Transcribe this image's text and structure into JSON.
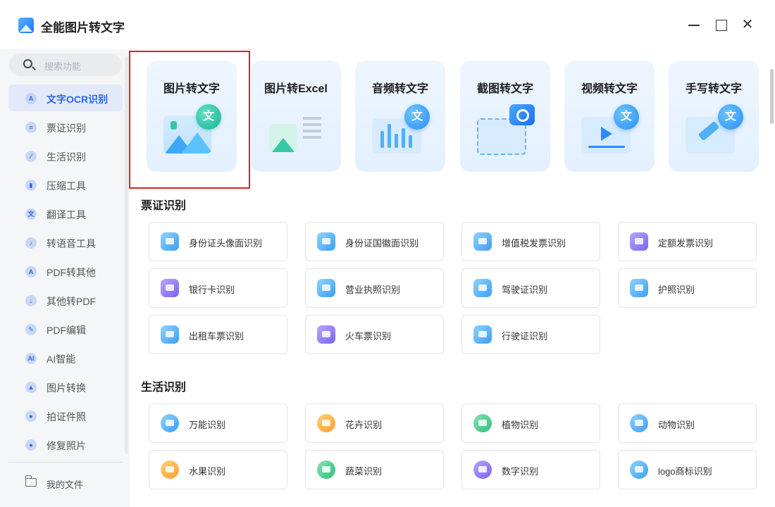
{
  "app": {
    "title": "全能图片转文字"
  },
  "window_controls": {
    "close_glyph": "✕"
  },
  "sidebar": {
    "search_placeholder": "搜索功能",
    "items": [
      {
        "label": "文字OCR识别",
        "icon": "ocr-icon",
        "glyph": "A",
        "active": true
      },
      {
        "label": "票证识别",
        "icon": "ticket-icon",
        "glyph": "≡"
      },
      {
        "label": "生活识别",
        "icon": "life-icon",
        "glyph": "⁄"
      },
      {
        "label": "压缩工具",
        "icon": "compress-icon",
        "glyph": "▮"
      },
      {
        "label": "翻译工具",
        "icon": "translate-icon",
        "glyph": "文"
      },
      {
        "label": "转语音工具",
        "icon": "voice-icon",
        "glyph": "♪"
      },
      {
        "label": "PDF转其他",
        "icon": "pdf-convert-icon",
        "glyph": "A"
      },
      {
        "label": "其他转PDF",
        "icon": "to-pdf-icon",
        "glyph": "↓"
      },
      {
        "label": "PDF编辑",
        "icon": "pdf-edit-icon",
        "glyph": "✎"
      },
      {
        "label": "AI智能",
        "icon": "ai-icon",
        "glyph": "AI"
      },
      {
        "label": "图片转换",
        "icon": "image-convert-icon",
        "glyph": "▲"
      },
      {
        "label": "拍证件照",
        "icon": "id-photo-icon",
        "glyph": "●"
      },
      {
        "label": "修复照片",
        "icon": "repair-photo-icon",
        "glyph": "●"
      }
    ],
    "files_label": "我的文件"
  },
  "features": [
    {
      "title": "图片转文字",
      "badge": "文",
      "selected": true
    },
    {
      "title": "图片转Excel"
    },
    {
      "title": "音频转文字",
      "badge": "文"
    },
    {
      "title": "截图转文字"
    },
    {
      "title": "视频转文字",
      "badge": "文"
    },
    {
      "title": "手写转文字",
      "badge": "文"
    }
  ],
  "sections": [
    {
      "title": "票证识别",
      "items": [
        {
          "label": "身份证头像面识别",
          "color": "blue"
        },
        {
          "label": "身份证国徽面识别",
          "color": "blue"
        },
        {
          "label": "增值税发票识别",
          "color": "blue"
        },
        {
          "label": "定额发票识别",
          "color": "purple"
        },
        {
          "label": "银行卡识别",
          "color": "purple"
        },
        {
          "label": "营业执照识别",
          "color": "blue"
        },
        {
          "label": "驾驶证识别",
          "color": "blue"
        },
        {
          "label": "护照识别",
          "color": "blue"
        },
        {
          "label": "出租车票识别",
          "color": "blue"
        },
        {
          "label": "火车票识别",
          "color": "purple"
        },
        {
          "label": "行驶证识别",
          "color": "blue"
        }
      ]
    },
    {
      "title": "生活识别",
      "items": [
        {
          "label": "万能识别",
          "color": "blue"
        },
        {
          "label": "花卉识别",
          "color": "orange"
        },
        {
          "label": "植物识别",
          "color": "green"
        },
        {
          "label": "动物识别",
          "color": "blue"
        },
        {
          "label": "水果识别",
          "color": "orange"
        },
        {
          "label": "蔬菜识别",
          "color": "green"
        },
        {
          "label": "数字识别",
          "color": "purple"
        },
        {
          "label": "logo商标识别",
          "color": "blue"
        }
      ]
    }
  ],
  "colors": {
    "accent": "#2f66e6",
    "highlight": "#e02020"
  }
}
